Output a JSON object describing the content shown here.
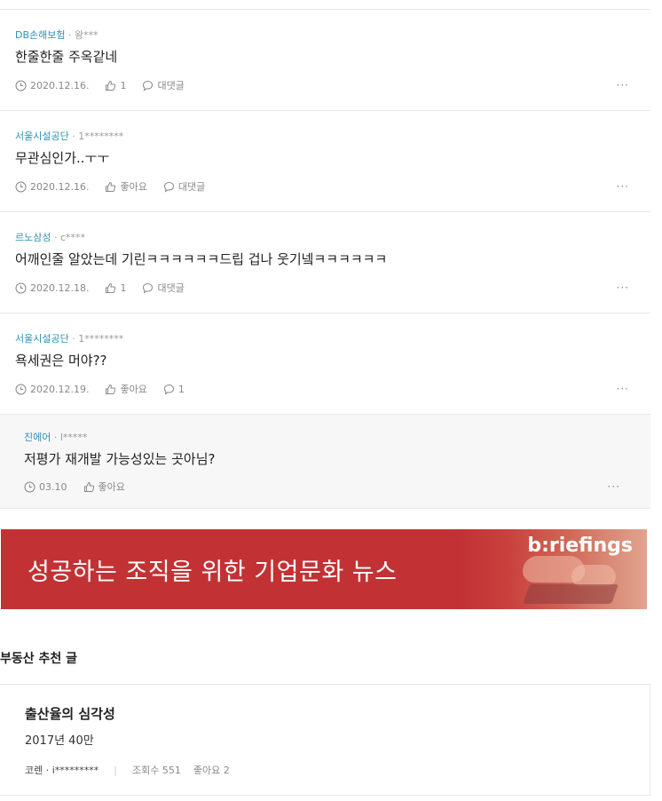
{
  "comments": [
    {
      "company": "DB손해보험",
      "author": "왕***",
      "body": "한줄한줄 주옥같네",
      "date": "2020.12.16.",
      "likes": "1",
      "replies": "대댓글"
    },
    {
      "company": "서울시설공단",
      "author": "1********",
      "body": "무관심인가..ㅜㅜ",
      "date": "2020.12.16.",
      "likes": "좋아요",
      "replies": "대댓글"
    },
    {
      "company": "르노삼성",
      "author": "c****",
      "body": "어깨인줄 알았는데 기린ㅋㅋㅋㅋㅋㅋ드립 겁나 웃기넼ㅋㅋㅋㅋㅋㅋ",
      "date": "2020.12.18.",
      "likes": "1",
      "replies": "대댓글"
    },
    {
      "company": "서울시설공단",
      "author": "1********",
      "body": "욕세권은 머야??",
      "date": "2020.12.19.",
      "likes": "좋아요",
      "replies": "1"
    }
  ],
  "reply": {
    "company": "진에어",
    "author": "l*****",
    "body": "저평가 재개발 가능성있는 곳아님?",
    "date": "03.10",
    "likes": "좋아요"
  },
  "more_label": "···",
  "separator": " · ",
  "banner": {
    "text": "성공하는 조직을 위한 기업문화 뉴스",
    "brand": "b:riefings"
  },
  "section": {
    "title": "부동산 추천 글"
  },
  "recommended": {
    "title": "출산율의 심각성",
    "snippet": "2017년 40만",
    "author": "코렌 · i*********",
    "divider": "|",
    "views": "조회수 551",
    "likes": "좋아요 2"
  }
}
